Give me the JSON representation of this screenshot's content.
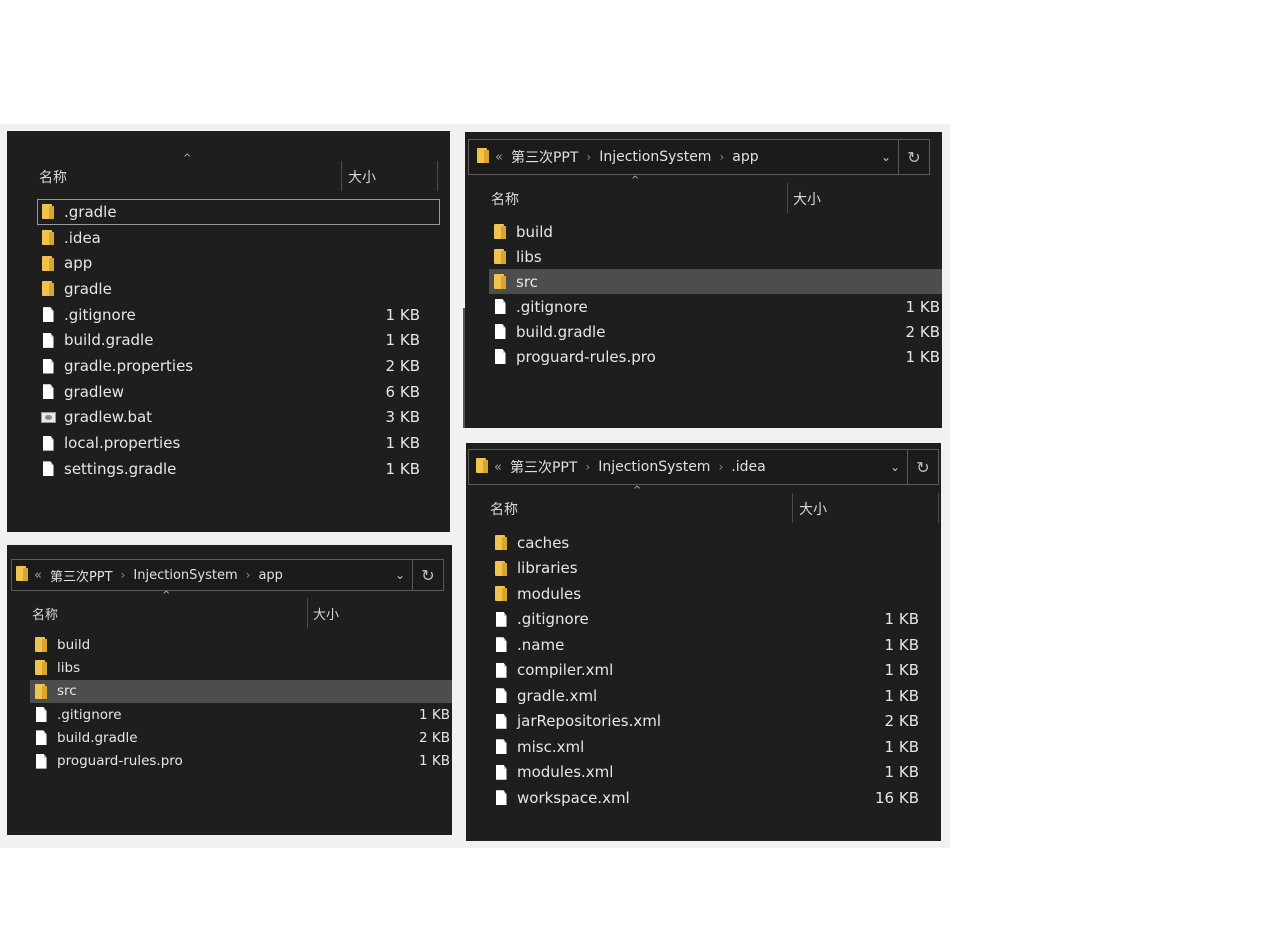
{
  "columns": {
    "name": "名称",
    "size": "大小"
  },
  "icons": {
    "folder": "folder-icon",
    "file": "file-icon",
    "batch": "batch-file-icon",
    "expand": "chevron-down-icon",
    "refresh": "refresh-icon"
  },
  "glyphs": {
    "overflow": "«",
    "separator": "›",
    "chevron": "⌄",
    "refresh": "↻",
    "sort_caret": "^"
  },
  "pane_root": {
    "rows": [
      {
        "name": ".gradle",
        "size": "",
        "type": "folder",
        "focused": true
      },
      {
        "name": ".idea",
        "size": "",
        "type": "folder"
      },
      {
        "name": "app",
        "size": "",
        "type": "folder"
      },
      {
        "name": "gradle",
        "size": "",
        "type": "folder"
      },
      {
        "name": ".gitignore",
        "size": "1 KB",
        "type": "file"
      },
      {
        "name": "build.gradle",
        "size": "1 KB",
        "type": "file"
      },
      {
        "name": "gradle.properties",
        "size": "2 KB",
        "type": "file"
      },
      {
        "name": "gradlew",
        "size": "6 KB",
        "type": "file"
      },
      {
        "name": "gradlew.bat",
        "size": "3 KB",
        "type": "batch"
      },
      {
        "name": "local.properties",
        "size": "1 KB",
        "type": "file"
      },
      {
        "name": "settings.gradle",
        "size": "1 KB",
        "type": "file"
      }
    ]
  },
  "pane_app_top": {
    "breadcrumb": [
      "第三次PPT",
      "InjectionSystem",
      "app"
    ],
    "rows": [
      {
        "name": "build",
        "size": "",
        "type": "folder"
      },
      {
        "name": "libs",
        "size": "",
        "type": "folder"
      },
      {
        "name": "src",
        "size": "",
        "type": "folder",
        "selected": true
      },
      {
        "name": ".gitignore",
        "size": "1 KB",
        "type": "file"
      },
      {
        "name": "build.gradle",
        "size": "2 KB",
        "type": "file"
      },
      {
        "name": "proguard-rules.pro",
        "size": "1 KB",
        "type": "file"
      }
    ]
  },
  "pane_app_bottom": {
    "breadcrumb": [
      "第三次PPT",
      "InjectionSystem",
      "app"
    ],
    "rows": [
      {
        "name": "build",
        "size": "",
        "type": "folder"
      },
      {
        "name": "libs",
        "size": "",
        "type": "folder"
      },
      {
        "name": "src",
        "size": "",
        "type": "folder",
        "selected": true
      },
      {
        "name": ".gitignore",
        "size": "1 KB",
        "type": "file"
      },
      {
        "name": "build.gradle",
        "size": "2 KB",
        "type": "file"
      },
      {
        "name": "proguard-rules.pro",
        "size": "1 KB",
        "type": "file"
      }
    ]
  },
  "pane_idea": {
    "breadcrumb": [
      "第三次PPT",
      "InjectionSystem",
      ".idea"
    ],
    "rows": [
      {
        "name": "caches",
        "size": "",
        "type": "folder"
      },
      {
        "name": "libraries",
        "size": "",
        "type": "folder"
      },
      {
        "name": "modules",
        "size": "",
        "type": "folder"
      },
      {
        "name": ".gitignore",
        "size": "1 KB",
        "type": "file"
      },
      {
        "name": ".name",
        "size": "1 KB",
        "type": "file"
      },
      {
        "name": "compiler.xml",
        "size": "1 KB",
        "type": "file"
      },
      {
        "name": "gradle.xml",
        "size": "1 KB",
        "type": "file"
      },
      {
        "name": "jarRepositories.xml",
        "size": "2 KB",
        "type": "file"
      },
      {
        "name": "misc.xml",
        "size": "1 KB",
        "type": "file"
      },
      {
        "name": "modules.xml",
        "size": "1 KB",
        "type": "file"
      },
      {
        "name": "workspace.xml",
        "size": "16 KB",
        "type": "file"
      }
    ]
  }
}
